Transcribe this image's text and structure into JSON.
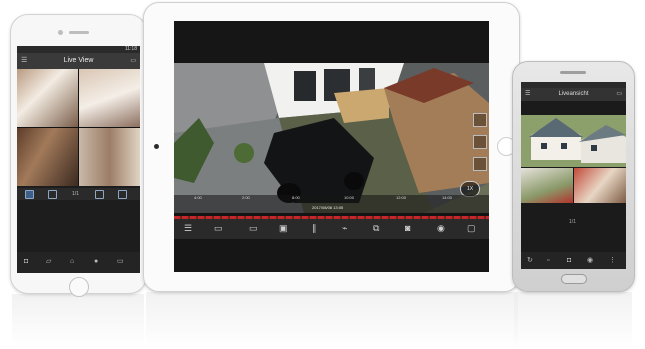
{
  "iphone": {
    "status_time": "11:18",
    "title": "Live View",
    "page_indicator": "1/1"
  },
  "ipad": {
    "timeline_date": "2017/08/08 13:05",
    "speed_label": "1X",
    "time_ticks": [
      "4:00",
      "2:00",
      "8:00",
      "10:00",
      "12:00",
      "14:00"
    ]
  },
  "android": {
    "title": "Liveansicht",
    "page_indicator": "1/1"
  }
}
